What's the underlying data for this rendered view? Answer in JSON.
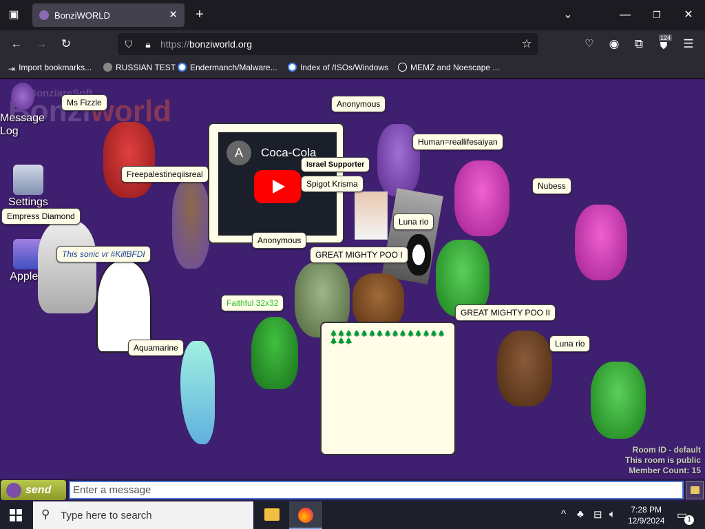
{
  "browser": {
    "tab_title": "BonziWORLD",
    "url_prefix": "https://",
    "url_host": "bonziworld.org",
    "extension_badge": "124",
    "bookmarks": [
      "Import bookmarks...",
      "RUSSIAN TEST",
      "Endermanch/Malware...",
      "Index of /ISOs/Windows",
      "MEMZ and Noescape ..."
    ]
  },
  "page": {
    "logo_small": "Bonzi",
    "logo_small_suffix": "areSoft",
    "logo_bonzi": "Bonzi",
    "logo_world": "world",
    "desktop_icons": {
      "message_log": "Message Log",
      "settings": "Settings",
      "applets": "Applets"
    },
    "users": [
      "Ms Fizzle",
      "Anonymous",
      "Human=reallifesaiyan",
      "Freepalestineqiisreal",
      "Israel Supporter",
      "Spigot Krisma",
      "Nubess",
      "Empress Diamond",
      "Luna rio",
      "Anonymous",
      "This sonic vr #KillBFDI",
      "GREAT MIGHTY POO I",
      "GREAT MIGHTY POO II",
      "Faithful 32x32",
      "Luna rio",
      "Aquamarine"
    ],
    "video": {
      "channel_initial": "A",
      "title": "Coca-Cola"
    },
    "bubble_text": "🌲🌲🌲🌲🌲🌲🌲🌲🌲🌲🌲🌲🌲🌲🌲🌲🌲🌲",
    "room": {
      "line1": "Room ID - default",
      "line2": "This room is public",
      "line3": "Member Count: 15"
    }
  },
  "chat": {
    "send_label": "send",
    "placeholder": "Enter a message"
  },
  "taskbar": {
    "search_placeholder": "Type here to search",
    "time": "7:28 PM",
    "date": "12/9/2024",
    "notification_count": "1"
  },
  "colors": {
    "page_bg": "#3f1f6f",
    "namebox_bg": "#fffde8",
    "purple_bonzi": "#8a5ac8",
    "pink_bonzi": "#d040b0",
    "red_bonzi": "#c02828",
    "green_bonzi": "#2aa02a",
    "brown_bonzi": "#6a3a1a"
  }
}
